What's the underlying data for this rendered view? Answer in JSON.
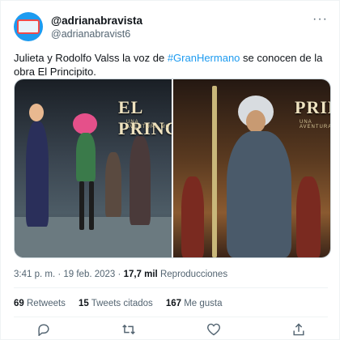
{
  "user": {
    "display_name": "@adrianabravista",
    "handle": "@adrianabravist6"
  },
  "tweet": {
    "text_before": "Julieta y Rodolfo Valss la voz de ",
    "hashtag": "#GranHermano",
    "text_after": " se conocen de la obra El Principito."
  },
  "media": {
    "left_logo": "EL PRINCIPI",
    "left_sub": "UNA AVENTURA MU",
    "right_logo": "PRINC",
    "right_sub": "UNA AVENTURA"
  },
  "meta": {
    "time": "3:41 p. m.",
    "separator": " · ",
    "date": "19 feb. 2023",
    "views_count": "17,7 mil",
    "views_label": "Reproducciones"
  },
  "stats": {
    "retweets_count": "69",
    "retweets_label": "Retweets",
    "quotes_count": "15",
    "quotes_label": "Tweets citados",
    "likes_count": "167",
    "likes_label": "Me gusta"
  },
  "icons": {
    "more": "more-icon",
    "reply": "reply-icon",
    "retweet": "retweet-icon",
    "like": "heart-icon",
    "share": "share-icon"
  },
  "colors": {
    "accent": "#1d9bf0",
    "muted": "#536471",
    "text": "#0f1419"
  }
}
